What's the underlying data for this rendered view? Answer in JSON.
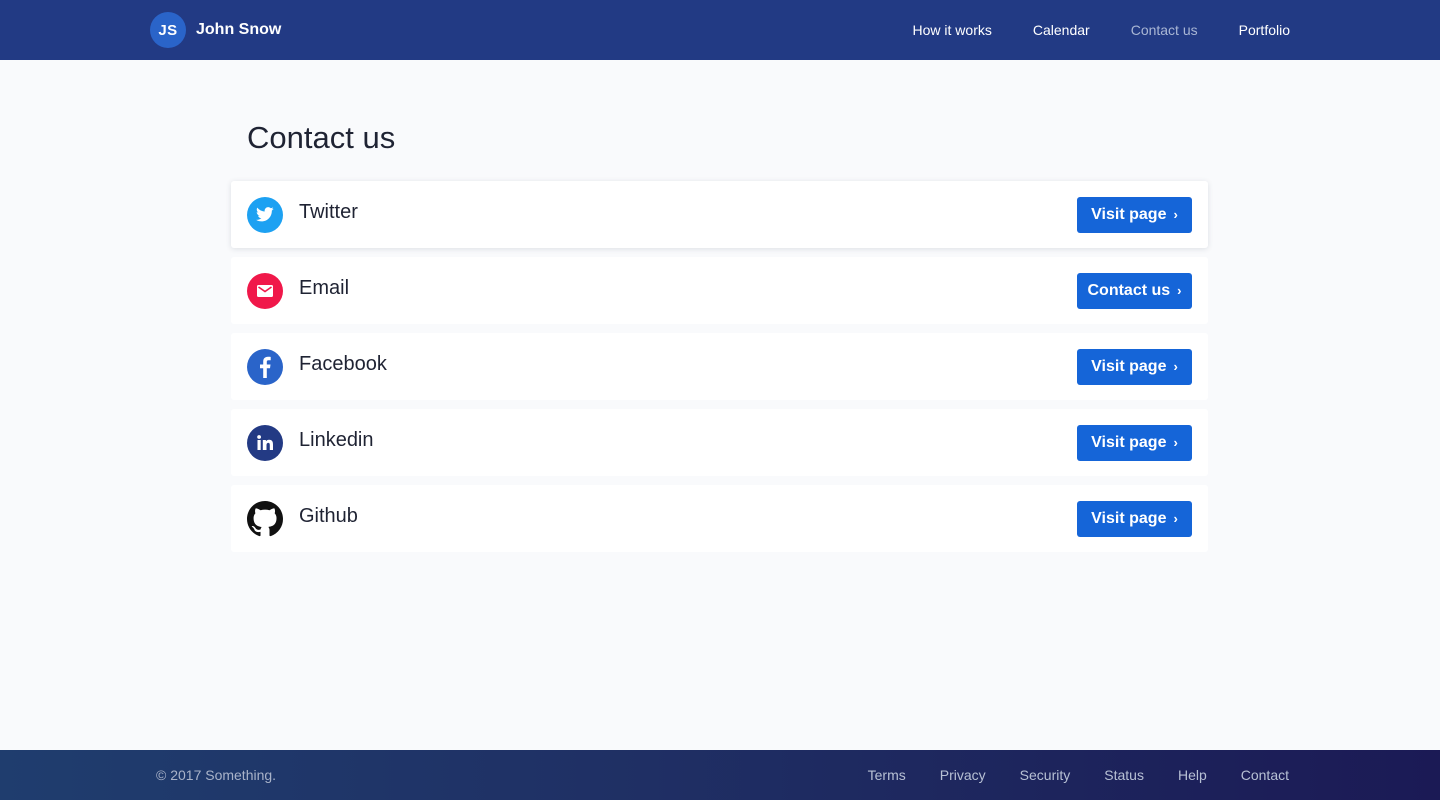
{
  "header": {
    "avatar_initials": "JS",
    "user_name": "John Snow",
    "nav": [
      {
        "label": "How it works",
        "active": false
      },
      {
        "label": "Calendar",
        "active": false
      },
      {
        "label": "Contact us",
        "active": true
      },
      {
        "label": "Portfolio",
        "active": false
      }
    ]
  },
  "main": {
    "title": "Contact us",
    "items": [
      {
        "label": "Twitter",
        "icon": "twitter-icon",
        "icon_color": "#1da1f2",
        "button": "Visit page"
      },
      {
        "label": "Email",
        "icon": "mail-icon",
        "icon_color": "#f0184a",
        "button": "Contact us"
      },
      {
        "label": "Facebook",
        "icon": "facebook-icon",
        "icon_color": "#2a64c9",
        "button": "Visit page"
      },
      {
        "label": "Linkedin",
        "icon": "linkedin-icon",
        "icon_color": "#233a84",
        "button": "Visit page"
      },
      {
        "label": "Github",
        "icon": "github-icon",
        "icon_color": "#111111",
        "button": "Visit page"
      }
    ]
  },
  "footer": {
    "copyright": "© 2017 Something.",
    "links": [
      "Terms",
      "Privacy",
      "Security",
      "Status",
      "Help",
      "Contact"
    ]
  },
  "colors": {
    "header_bg": "#223a84",
    "button_bg": "#1565d8",
    "page_bg": "#f9fafc"
  }
}
